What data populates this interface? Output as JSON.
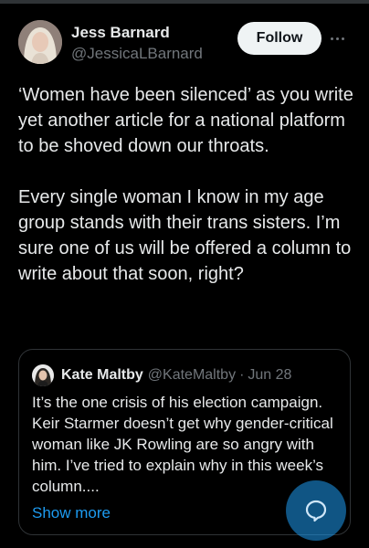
{
  "post": {
    "author": {
      "name": "Jess Barnard",
      "handle": "@JessicaLBarnard"
    },
    "follow_label": "Follow",
    "text": "‘Women have been silenced’ as you write yet another article for a national platform to be shoved down our throats.\n\nEvery single woman I know in my age group stands with their trans sisters. I’m sure one of us will be offered a column to write about that soon, right?"
  },
  "quoted": {
    "name": "Kate Maltby",
    "handle": "@KateMaltby",
    "separator": "·",
    "date": "Jun 28",
    "text": "It’s the one crisis of his election campaign. Keir Starmer doesn’t get why gender-critical woman like JK Rowling are so angry with him. I’ve tried to explain why in this week’s column....",
    "show_more": "Show more"
  },
  "icons": {
    "more": "more-horizontal-icon",
    "compose": "compose-reply-icon"
  },
  "colors": {
    "background": "#000000",
    "text": "#e7e9ea",
    "secondary": "#71767b",
    "accent": "#1d9bf0",
    "follow_bg": "#eff3f4"
  }
}
